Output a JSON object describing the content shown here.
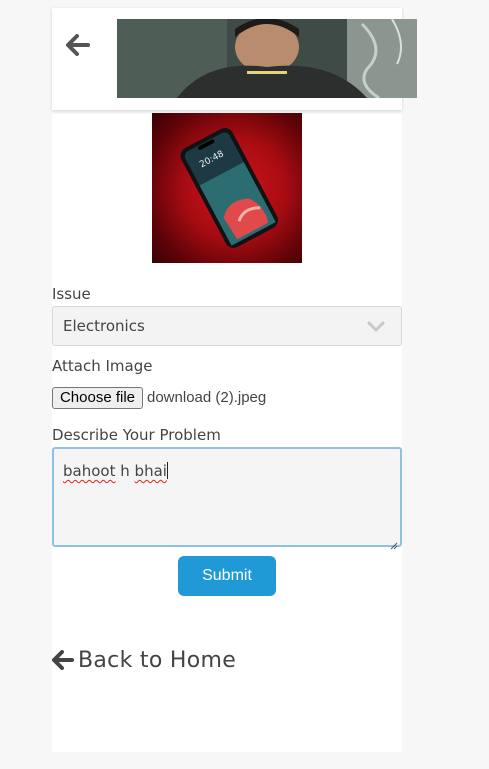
{
  "header": {
    "back_icon": "arrow-left-icon"
  },
  "form": {
    "issue_label": "Issue",
    "issue_value": "Electronics",
    "attach_label": "Attach Image",
    "file_button_label": "Choose file",
    "file_name": "download (2).jpeg",
    "describe_label": "Describe Your Problem",
    "description_words": [
      "bahoot",
      "h",
      "bhai"
    ],
    "submit_label": "Submit"
  },
  "footer": {
    "back_home_label": "Back to Home",
    "back_home_icon": "arrow-left-icon"
  },
  "colors": {
    "accent": "#1f9ad6",
    "focus_border": "#8ec1e6",
    "background": "#f7f7f7"
  }
}
